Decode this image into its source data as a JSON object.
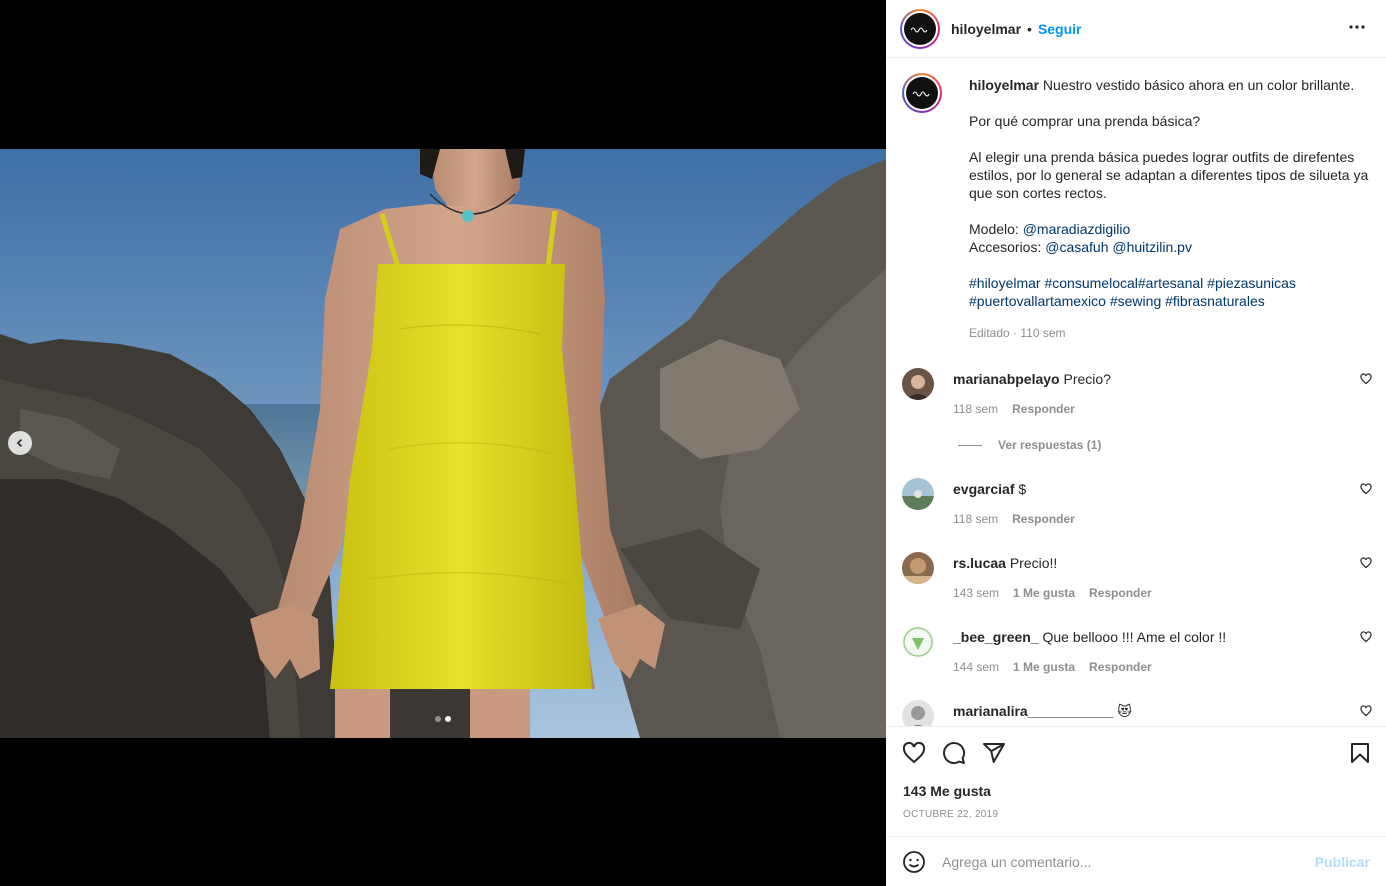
{
  "post": {
    "username": "hiloyelmar",
    "separator": "•",
    "follow_label": "Seguir",
    "more_icon": "more-horizontal-icon",
    "image_alt": "Modelo con vestido amarillo en la playa entre rocas",
    "carousel": {
      "slides": 2,
      "active": 2
    }
  },
  "caption": {
    "username": "hiloyelmar",
    "first_line": "Nuestro vestido básico ahora en un color brillante.",
    "question": "Por qué comprar una prenda básica?",
    "body_1": "Al elegir una prenda básica puedes lograr outfits de direfentes",
    "body_2": "estilos, por lo general se adaptan a diferentes tipos de silueta ya",
    "body_3": "que son cortes rectos.",
    "model_label": "Modelo:",
    "model_link": "@maradiazdigilio",
    "acc_label": "Accesorios:",
    "acc_link_1": "@casafuh",
    "acc_link_2": "@huitzilin.pv",
    "tags_1a": "#hiloyelmar",
    "tags_1b": "#consumelocal",
    "tags_1c": "#artesanal",
    "tags_1d": "#piezasunicas",
    "tags_2a": "#puertovallartamexico",
    "tags_2b": "#sewing",
    "tags_2c": "#fibrasnaturales",
    "meta": "Editado · 110 sem"
  },
  "comments": [
    {
      "user": "marianabpelayo",
      "text": "Precio?",
      "time": "118 sem",
      "likes": "",
      "reply": "Responder",
      "view_replies": "Ver respuestas (1)"
    },
    {
      "user": "evgarciaf",
      "text": "$",
      "time": "118 sem",
      "likes": "",
      "reply": "Responder"
    },
    {
      "user": "rs.lucaa",
      "text": "Precio!!",
      "time": "143 sem",
      "likes": "1 Me gusta",
      "reply": "Responder"
    },
    {
      "user": "_bee_green_",
      "text": "Que bellooo !!! Ame el color !!",
      "time": "144 sem",
      "likes": "1 Me gusta",
      "reply": "Responder"
    },
    {
      "user": "marianalira___________",
      "text": "😻",
      "time": "",
      "likes": "",
      "reply": ""
    }
  ],
  "actions": {
    "likes": "143 Me gusta",
    "date": "OCTUBRE 22, 2019"
  },
  "add_comment": {
    "placeholder": "Agrega un comentario...",
    "publish": "Publicar"
  },
  "colors": {
    "link": "#00376b",
    "follow": "#0095f6",
    "publish_disabled": "#b2dffc",
    "dress": "#e3dc1e"
  }
}
